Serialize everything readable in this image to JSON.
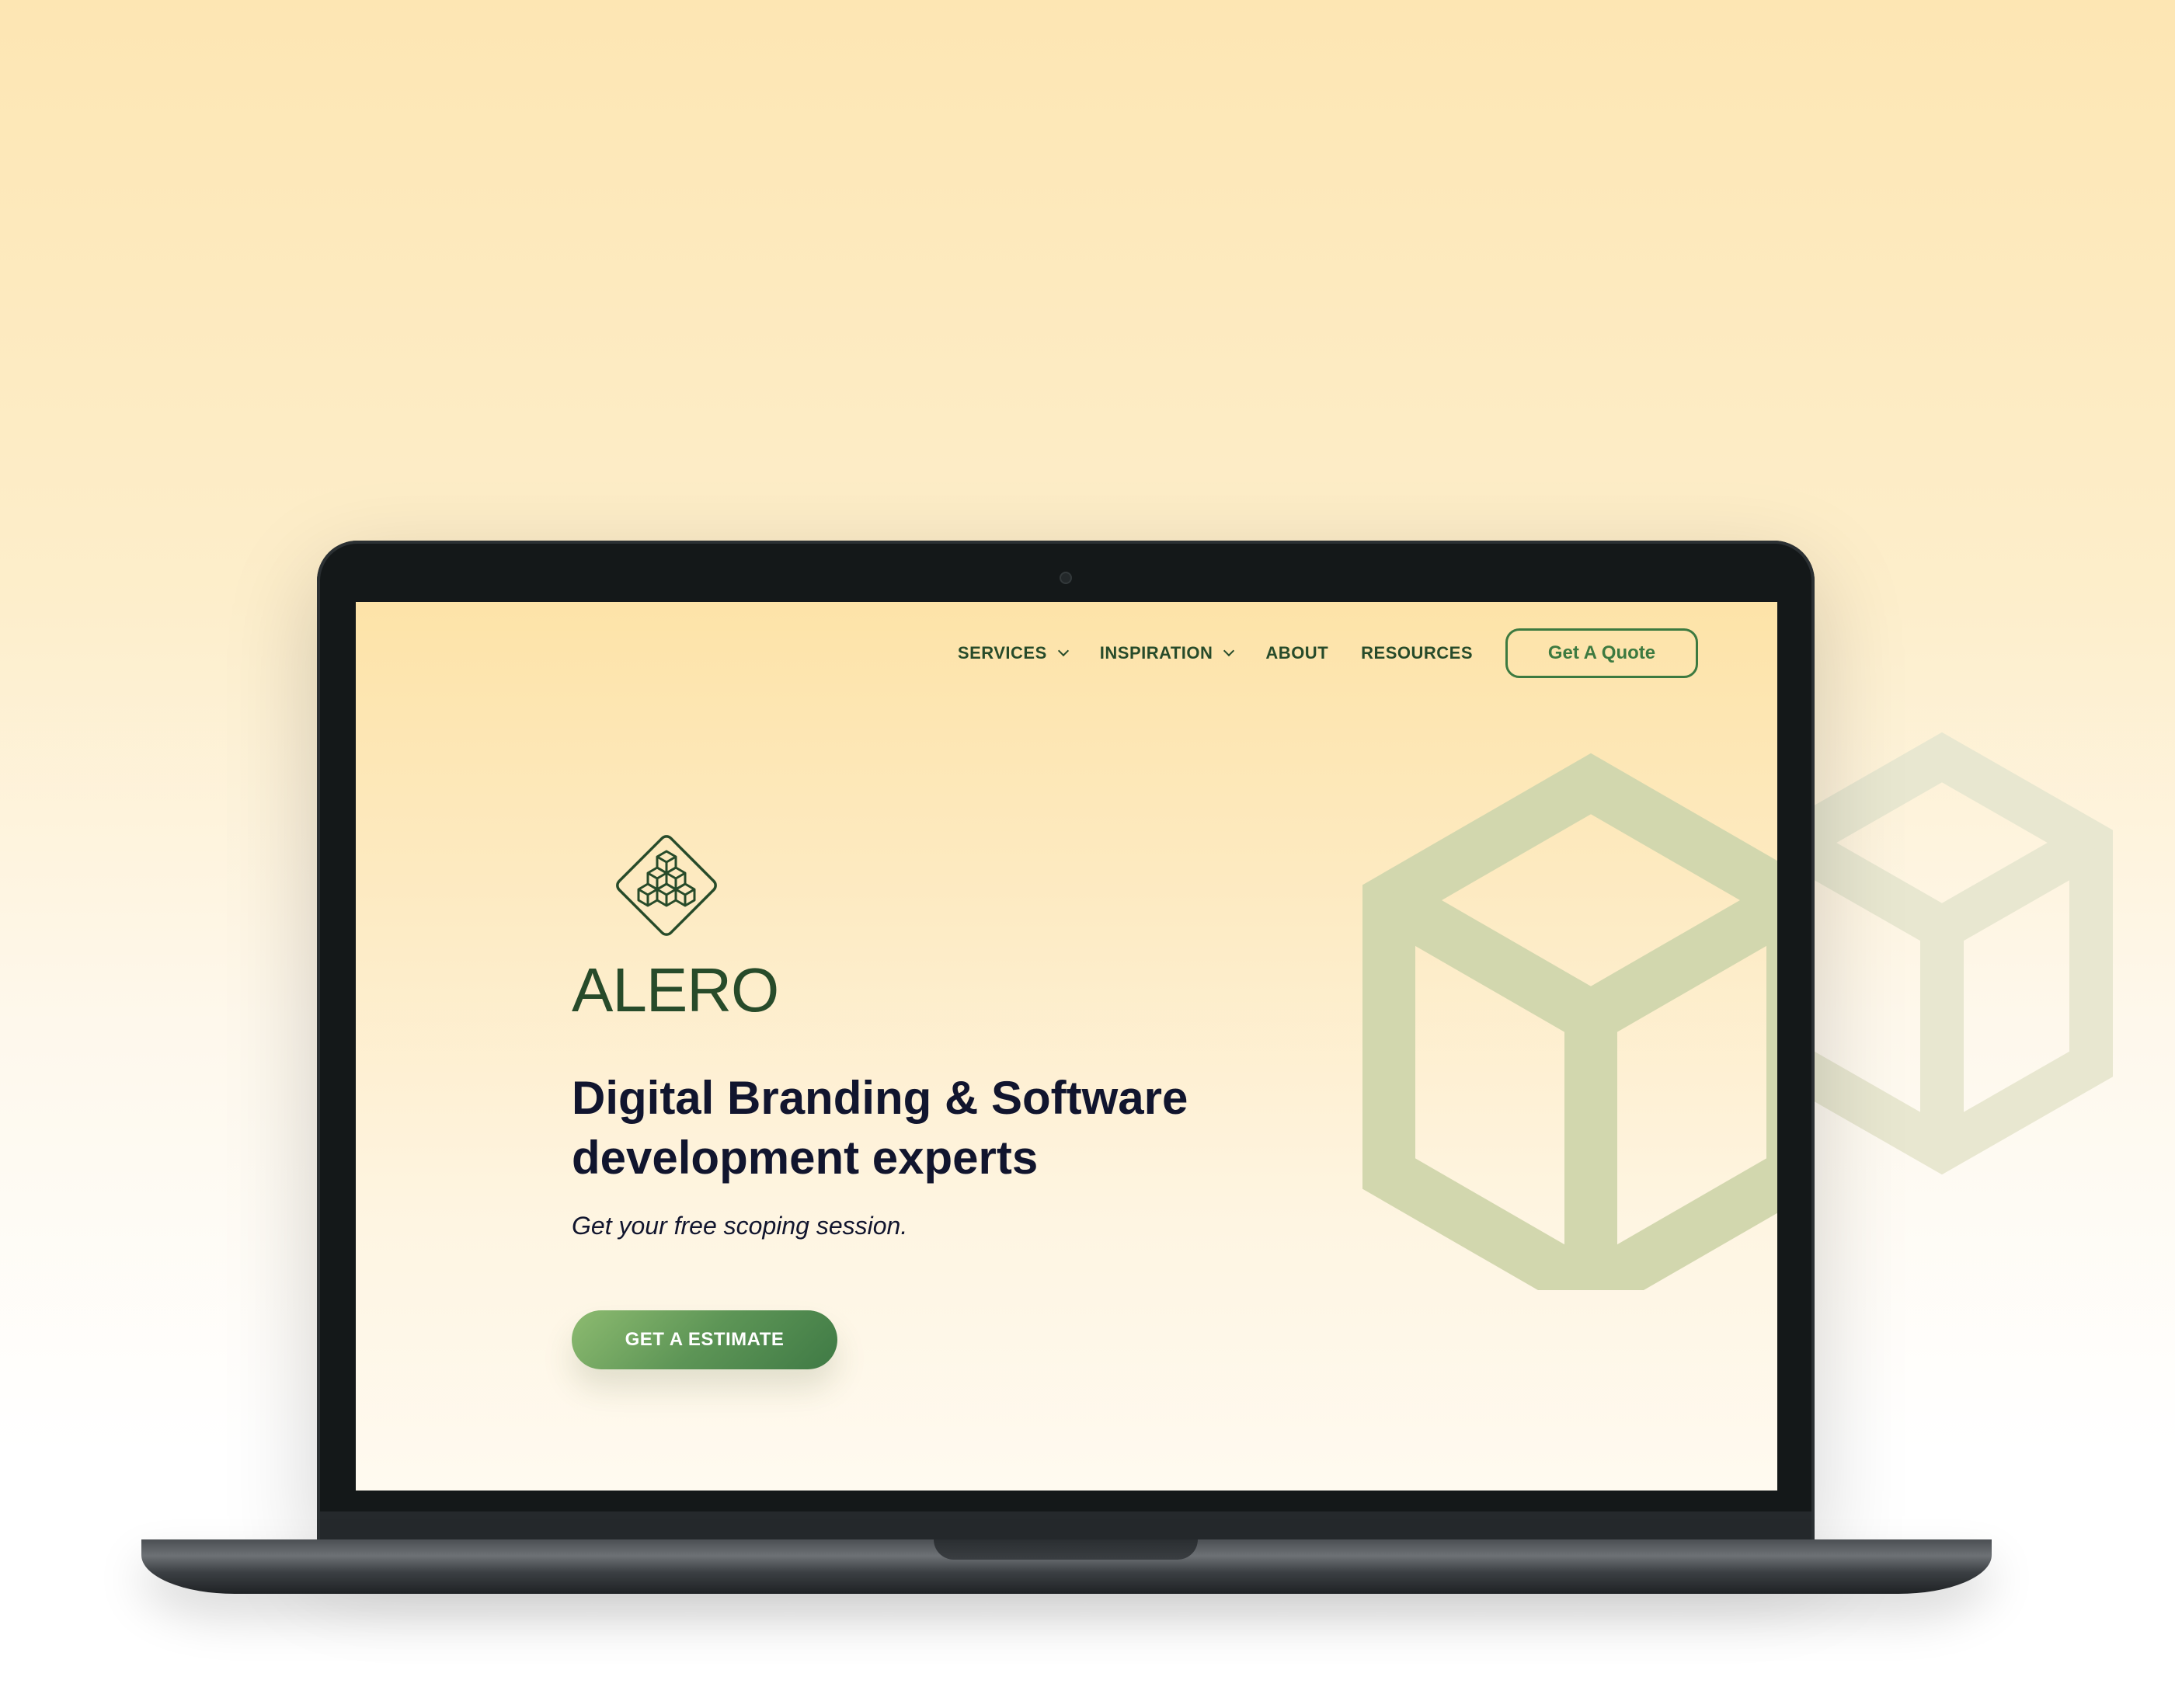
{
  "nav": {
    "items": [
      {
        "label": "SERVICES",
        "has_dropdown": true
      },
      {
        "label": "INSPIRATION",
        "has_dropdown": true
      },
      {
        "label": "ABOUT",
        "has_dropdown": false
      },
      {
        "label": "RESOURCES",
        "has_dropdown": false
      }
    ],
    "quote_button": "Get A Quote"
  },
  "hero": {
    "brand": "ALERO",
    "headline": "Digital Branding & Software development experts",
    "subline": "Get your free scoping session.",
    "cta": "GET A ESTIMATE"
  },
  "icons": {
    "logo": "stacked-cubes-diamond-logo",
    "decor": "cube-outline-icon",
    "dropdown": "chevron-down-icon"
  },
  "colors": {
    "brand_green": "#274b2a",
    "accent_green": "#3d7a40",
    "headline_navy": "#11152e",
    "background_top": "#fde3a8",
    "background_bottom": "#fffaf0",
    "cube_decor": "#d2d7ae",
    "laptop_bezel": "#141819"
  }
}
